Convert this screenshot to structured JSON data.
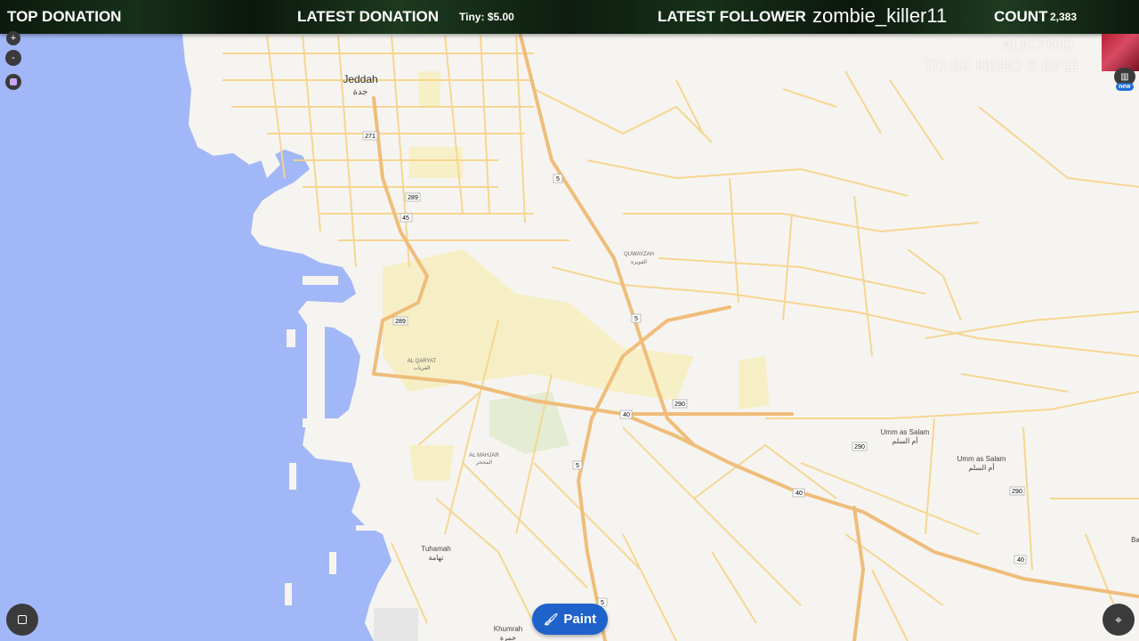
{
  "stream_bar": {
    "top_donation_label": "TOP DONATION",
    "latest_donation_label": "LATEST DONATION",
    "latest_donation_value": "Tiny: $5.00",
    "latest_follower_label": "LATEST FOLLOWER",
    "latest_follower_value": "zombie_killer11",
    "count_label": "COUNT",
    "count_value": "2,383"
  },
  "overlay": {
    "line1": "ALICTWD",
    "line2": "TO BE HERO X EP11"
  },
  "map_controls": {
    "zoom_in": "+",
    "zoom_out": "-",
    "new_badge": "new",
    "paint_button": "Paint"
  },
  "map_labels": {
    "jeddah": "Jeddah",
    "jeddah_ar": "جدة",
    "quwayzah": "QUWAYZAH",
    "quwayzah_ar": "القويزة",
    "al_qaryat": "AL QARYAT",
    "al_qaryat_ar": "القريات",
    "al_mahjar": "AL MAHJAR",
    "al_mahjar_ar": "المحجر",
    "umm_as_salam_1": "Umm as Salam",
    "umm_as_salam_1_ar": "أم السلم",
    "umm_as_salam_2": "Umm as Salam",
    "umm_as_salam_2_ar": "أم السلم",
    "tuhamah": "Tuhamah",
    "tuhamah_ar": "تهامة",
    "khumrah": "Khumrah",
    "khumrah_ar": "خمرة",
    "edge_label": "Ba"
  },
  "road_shields": [
    "271",
    "289",
    "45",
    "5",
    "289",
    "5",
    "40",
    "290",
    "5",
    "290",
    "40",
    "290",
    "40",
    "5"
  ],
  "colors": {
    "water": "#a2b7f7",
    "land": "#f6f4f0",
    "road": "#f5d58e",
    "highway": "#efbd7a",
    "park": "#f7efc2",
    "accent": "#1f62c9"
  }
}
